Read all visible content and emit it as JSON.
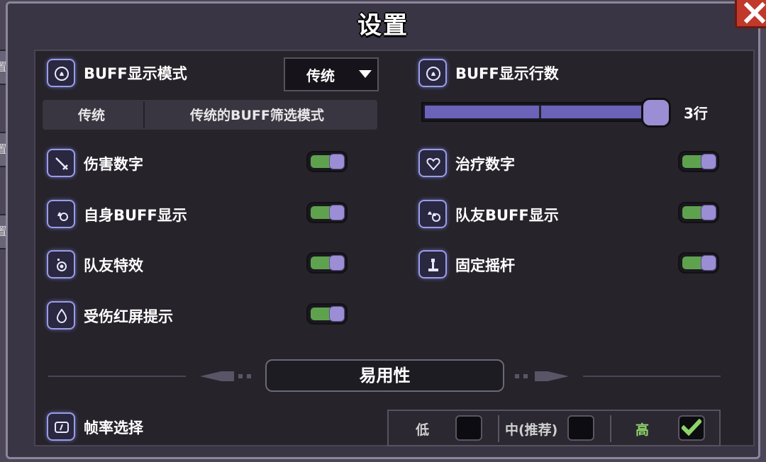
{
  "window": {
    "title": "设置"
  },
  "side_tabs": [
    "置",
    "置",
    "置"
  ],
  "buff_mode": {
    "label": "BUFF显示模式",
    "selected": "传统",
    "desc_name": "传统",
    "desc_text": "传统的BUFF筛选模式"
  },
  "buff_rows": {
    "label": "BUFF显示行数",
    "value_text": "3行",
    "fill_fraction": 1.0
  },
  "toggles_left": [
    {
      "label": "伤害数字",
      "icon": "sword-icon",
      "on": true
    },
    {
      "label": "自身BUFF显示",
      "icon": "self-buff-icon",
      "on": true
    },
    {
      "label": "队友特效",
      "icon": "teammate-effect-icon",
      "on": true
    },
    {
      "label": "受伤红屏提示",
      "icon": "blood-drop-icon",
      "on": true
    }
  ],
  "toggles_right": [
    {
      "label": "治疗数字",
      "icon": "heart-icon",
      "on": true
    },
    {
      "label": "队友BUFF显示",
      "icon": "team-buff-icon",
      "on": true
    },
    {
      "label": "固定摇杆",
      "icon": "joystick-icon",
      "on": true
    }
  ],
  "section": {
    "title": "易用性"
  },
  "fps": {
    "label": "帧率选择",
    "options": [
      {
        "label": "低",
        "checked": false
      },
      {
        "label": "中(推荐)",
        "checked": false
      },
      {
        "label": "高",
        "checked": true
      }
    ]
  },
  "colors": {
    "toggle_on": "#5fa24e",
    "accent": "#6a63b8",
    "selected_text": "#8fd46a",
    "close": "#c0392b"
  }
}
